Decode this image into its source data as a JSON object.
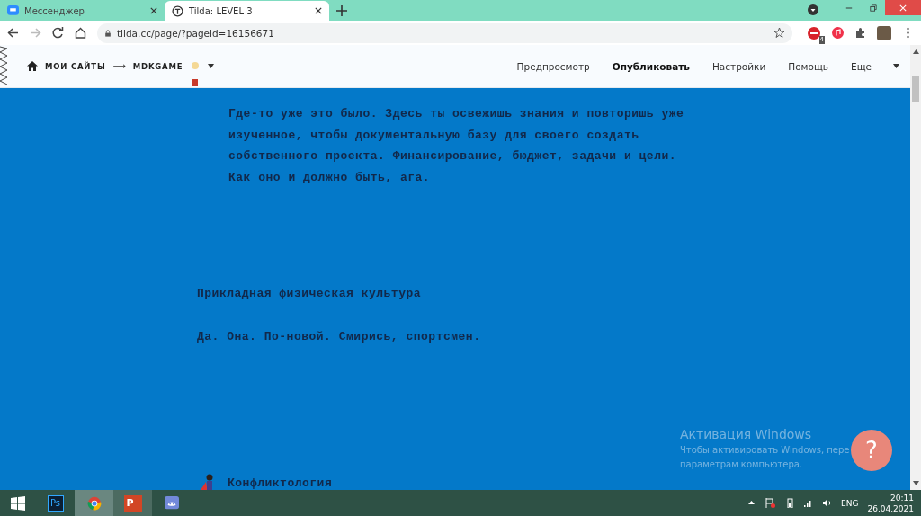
{
  "browser": {
    "tabs": [
      {
        "title": "Мессенджер",
        "kind": "messenger",
        "selected": false
      },
      {
        "title": "Tilda: LEVEL 3",
        "kind": "tilda",
        "selected": true
      }
    ],
    "url": "tilda.cc/page/?pageid=16156671",
    "extension_badge": "4"
  },
  "editor_toolbar": {
    "breadcrumb": [
      "МОИ САЙТЫ",
      "⟶",
      "MDKGAME"
    ],
    "menu": [
      {
        "label": "Предпросмотр",
        "kind": "link"
      },
      {
        "label": "Опубликовать",
        "kind": "primary"
      },
      {
        "label": "Настройки",
        "kind": "link"
      },
      {
        "label": "Помощь",
        "kind": "link"
      },
      {
        "label": "Еще",
        "kind": "dropdown"
      }
    ]
  },
  "content": [
    {
      "kind": "intro",
      "text": "Где-то уже это было. Здесь ты освежишь знания и повторишь уже изученное, чтобы документальную базу для своего создать собственного проекта. Финансирование, бюджет, задачи и цели. Как оно и должно быть, ага."
    },
    {
      "kind": "heading",
      "text": "Прикладная физическая культура"
    },
    {
      "kind": "text",
      "text": "Да. Она. По-новой. Смирись, спортсмен."
    },
    {
      "kind": "icon-heading",
      "text": "Конфликтология"
    }
  ],
  "activation_notice": {
    "title": "Активация Windows",
    "lines": [
      "Чтобы активировать Windows, пере",
      "параметрам компьютера."
    ]
  },
  "help_button": {
    "label": "?"
  },
  "taskbar": {
    "apps": [
      {
        "kind": "photoshop",
        "label": "Ps",
        "selected": false,
        "open": false
      },
      {
        "kind": "chrome",
        "selected": true,
        "open": true
      },
      {
        "kind": "powerpoint",
        "label": "P",
        "selected": false,
        "open": true
      },
      {
        "kind": "discord",
        "selected": false,
        "open": false
      }
    ],
    "language": "ENG",
    "time": "20:11",
    "date": "26.04.2021"
  }
}
